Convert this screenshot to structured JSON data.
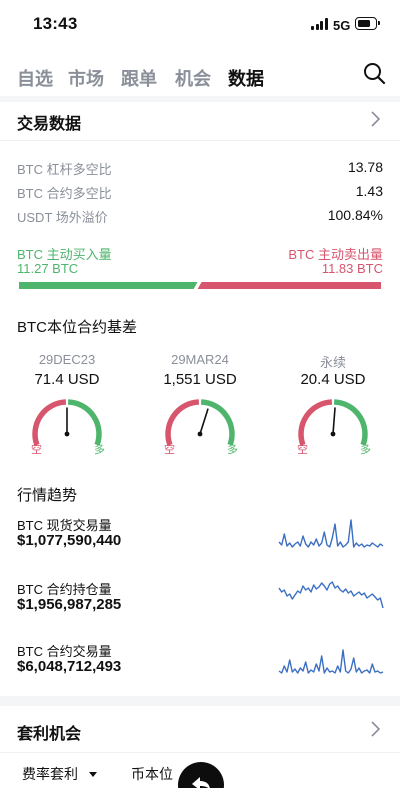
{
  "status": {
    "time": "13:43",
    "network": "5G"
  },
  "tabs": [
    {
      "label": "自选",
      "active": false
    },
    {
      "label": "市场",
      "active": false
    },
    {
      "label": "跟单",
      "active": false
    },
    {
      "label": "机会",
      "active": false
    },
    {
      "label": "数据",
      "active": true
    }
  ],
  "trade_data": {
    "title": "交易数据",
    "stats": [
      {
        "label": "BTC 杠杆多空比",
        "value": "13.78"
      },
      {
        "label": "BTC 合约多空比",
        "value": "1.43"
      },
      {
        "label": "USDT 场外溢价",
        "value": "100.84%"
      }
    ],
    "buy": {
      "label": "BTC 主动买入量",
      "value": "11.27 BTC"
    },
    "sell": {
      "label": "BTC 主动卖出量",
      "value": "11.83 BTC"
    },
    "buy_ratio": 0.488
  },
  "basis": {
    "title": "BTC本位合约基差",
    "short_label": "空",
    "long_label": "多",
    "items": [
      {
        "label": "29DEC23",
        "value": "71.4 USD",
        "level": 0.5
      },
      {
        "label": "29MAR24",
        "value": "1,551 USD",
        "level": 0.58
      },
      {
        "label": "永续",
        "value": "20.4 USD",
        "level": 0.52
      }
    ]
  },
  "trend": {
    "title": "行情趋势",
    "items": [
      {
        "label": "BTC 现货交易量",
        "value": "$1,077,590,440"
      },
      {
        "label": "BTC 合约持仓量",
        "value": "$1,956,987,285"
      },
      {
        "label": "BTC 合约交易量",
        "value": "$6,048,712,493"
      }
    ]
  },
  "arbitrage": {
    "title": "套利机会",
    "tabs": [
      "费率套利",
      "币本位"
    ]
  },
  "colors": {
    "green": "#4fb56c",
    "red": "#d7566e",
    "line": "#3b6fc4"
  }
}
